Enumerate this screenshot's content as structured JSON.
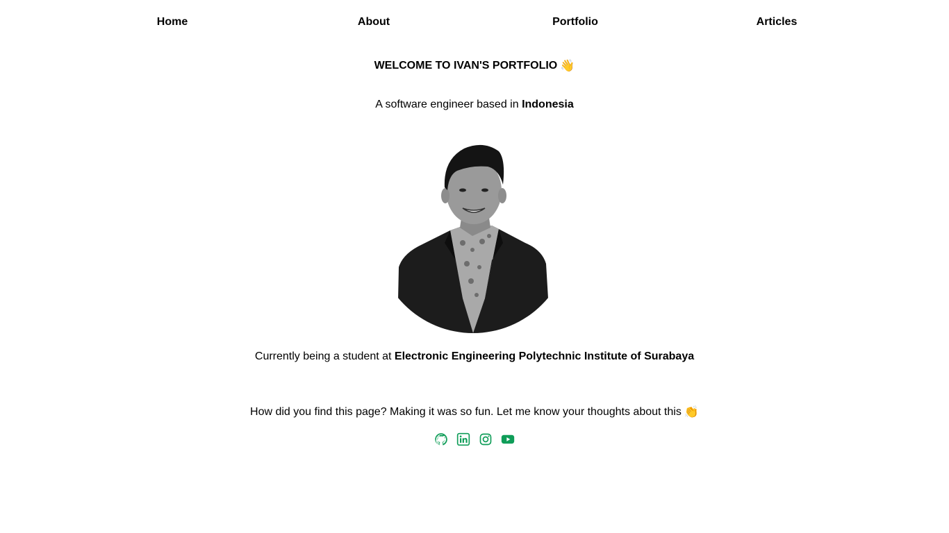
{
  "nav": {
    "items": [
      {
        "label": "Home"
      },
      {
        "label": "About"
      },
      {
        "label": "Portfolio"
      },
      {
        "label": "Articles"
      }
    ]
  },
  "hero": {
    "headline": "WELCOME TO IVAN'S PORTFOLIO",
    "headline_emoji": "👋",
    "tagline_prefix": "A software engineer based in ",
    "tagline_location": "Indonesia"
  },
  "education": {
    "prefix": "Currently being a student at ",
    "institution": "Electronic Engineering Polytechnic Institute of Surabaya"
  },
  "feedback": {
    "text": "How did you find this page? Making it was so fun. Let me know your thoughts about this",
    "emoji": "👏"
  },
  "social": {
    "accent_color": "#0f9d58",
    "icons": [
      "github-icon",
      "linkedin-icon",
      "instagram-icon",
      "youtube-icon"
    ]
  }
}
